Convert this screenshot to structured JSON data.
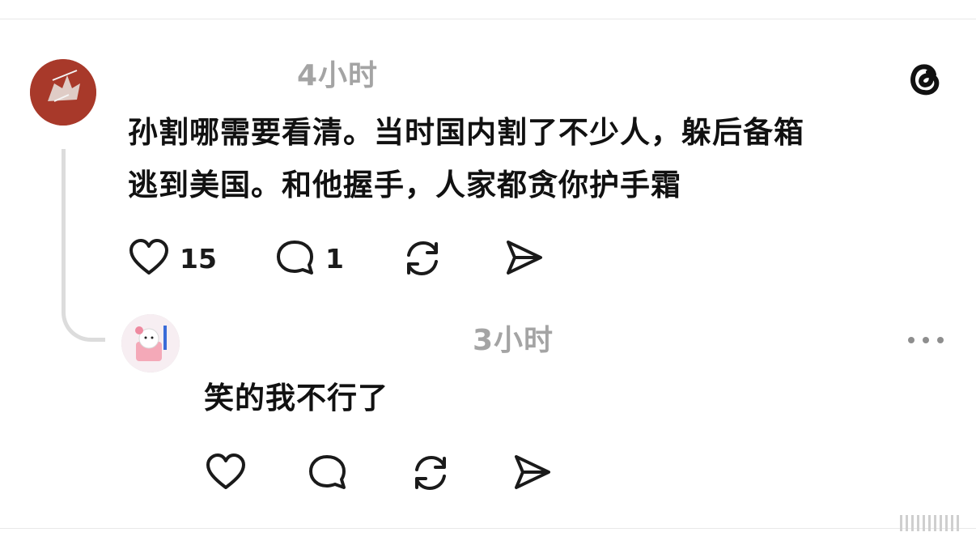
{
  "main_post": {
    "timestamp": "4小时",
    "text_line1": "孙割哪需要看清。当时国内割了不少人，躲后备箱",
    "text_line2": "逃到美国。和他握手，人家都贪你护手霜",
    "likes": "15",
    "replies": "1",
    "actions": [
      "heart-icon",
      "comment-icon",
      "repost-icon",
      "share-icon"
    ]
  },
  "reply": {
    "timestamp": "3小时",
    "text": "笑的我不行了",
    "actions": [
      "heart-icon",
      "comment-icon",
      "repost-icon",
      "share-icon"
    ]
  },
  "colors": {
    "text": "#111111",
    "muted": "#a4a4a4",
    "thread_line": "#dcdcdc",
    "main_avatar": "#a8392a"
  }
}
